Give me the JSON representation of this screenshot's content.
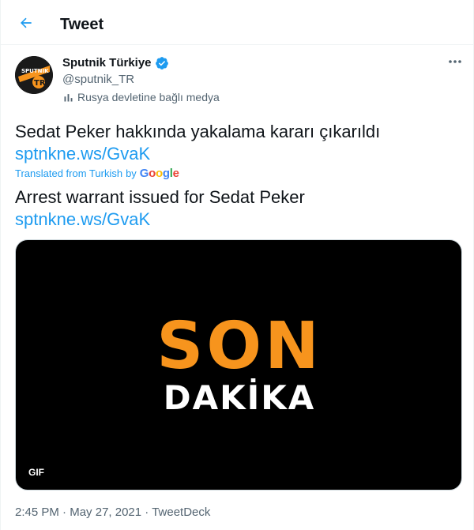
{
  "header": {
    "title": "Tweet"
  },
  "author": {
    "name": "Sputnik Türkiye",
    "handle": "@sputnik_TR",
    "affiliation": "Rusya devletine bağlı medya",
    "avatar_text_top": "SPUTNIK",
    "avatar_text_bottom": "TR"
  },
  "tweet": {
    "original_text": "Sedat Peker hakkında yakalama kararı çıkarıldı",
    "original_link": "sptnkne.ws/GvaK",
    "translated_from": "Translated from Turkish",
    "translated_by": "by",
    "translator": "Google",
    "translated_text": "Arrest warrant issued for Sedat Peker",
    "translated_link": "sptnkne.ws/GvaK"
  },
  "media": {
    "line1": "SON",
    "line2": "DAKİKA",
    "badge": "GIF"
  },
  "footer": {
    "time": "2:45 PM",
    "separator": "·",
    "date": "May 27, 2021",
    "source": "TweetDeck"
  },
  "colors": {
    "accent": "#1d9bf0",
    "text": "#0f1419",
    "secondary": "#536471",
    "son_orange": "#f7941d"
  }
}
